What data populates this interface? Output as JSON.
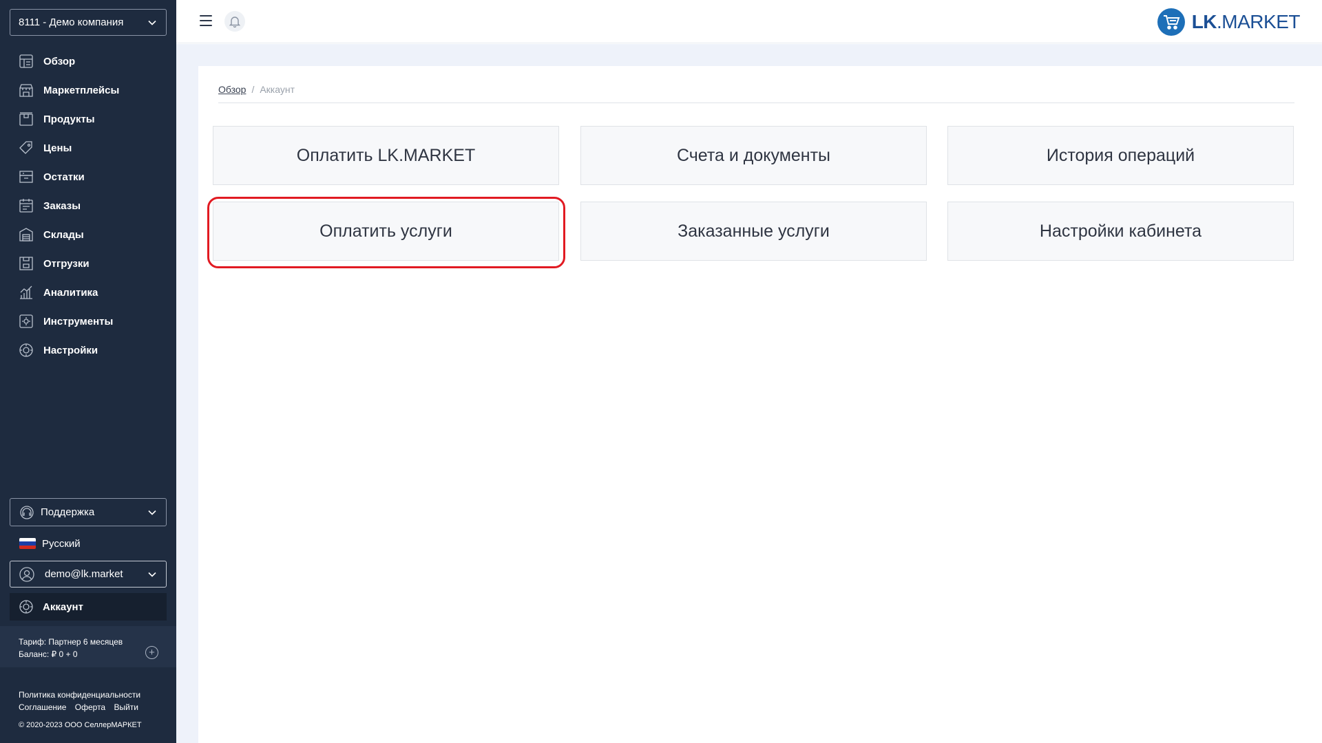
{
  "sidebar": {
    "company_select": "8111 - Демо компания",
    "nav": [
      {
        "label": "Обзор",
        "icon": "overview-icon"
      },
      {
        "label": "Маркетплейсы",
        "icon": "marketplaces-icon"
      },
      {
        "label": "Продукты",
        "icon": "products-icon"
      },
      {
        "label": "Цены",
        "icon": "prices-icon"
      },
      {
        "label": "Остатки",
        "icon": "stock-icon"
      },
      {
        "label": "Заказы",
        "icon": "orders-icon"
      },
      {
        "label": "Склады",
        "icon": "warehouses-icon"
      },
      {
        "label": "Отгрузки",
        "icon": "shipments-icon"
      },
      {
        "label": "Аналитика",
        "icon": "analytics-icon"
      },
      {
        "label": "Инструменты",
        "icon": "tools-icon"
      },
      {
        "label": "Настройки",
        "icon": "settings-icon"
      }
    ],
    "support_label": "Поддержка",
    "language": "Русский",
    "user_email": "demo@lk.market",
    "account_label": "Аккаунт",
    "tariff": "Тариф: Партнер 6 месяцев",
    "balance": "Баланс: ₽ 0 + 0",
    "footer": {
      "privacy": "Политика конфиденциальности",
      "agreement": "Соглашение",
      "offer": "Оферта",
      "logout": "Выйти",
      "copyright": "© 2020-2023 ООО СеллерМАРКЕТ"
    }
  },
  "header": {
    "logo_bold": "LK",
    "logo_rest": ".MARKET"
  },
  "breadcrumb": {
    "home": "Обзор",
    "separator": "/",
    "current": "Аккаунт"
  },
  "tiles": [
    "Оплатить LK.MARKET",
    "Счета и документы",
    "История операций",
    "Оплатить услуги",
    "Заказанные услуги",
    "Настройки кабинета"
  ],
  "colors": {
    "sidebar_bg": "#1e2b3f",
    "highlight": "#e11a22",
    "brand": "#1b4f95"
  }
}
